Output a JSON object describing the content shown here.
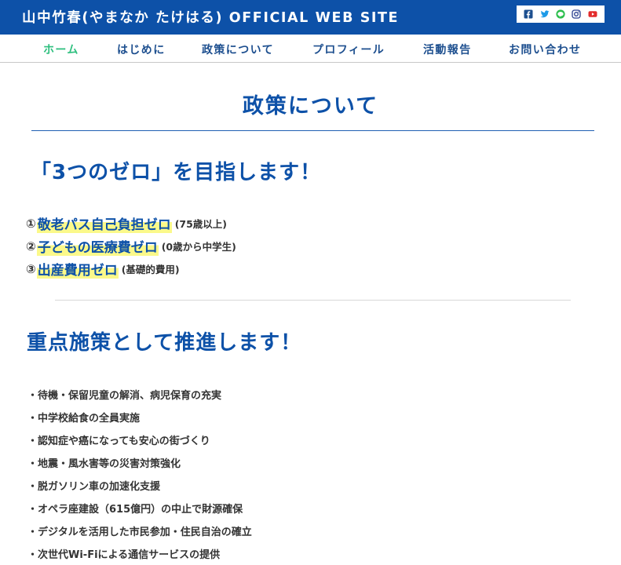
{
  "header": {
    "site_title": "山中竹春(やまなか たけはる) OFFICIAL WEB SITE",
    "social_icons": [
      "facebook-icon",
      "twitter-icon",
      "line-icon",
      "instagram-icon",
      "youtube-icon"
    ],
    "brand_color": "#0d51a8"
  },
  "nav": {
    "items": [
      {
        "label": "ホーム",
        "active": true
      },
      {
        "label": "はじめに",
        "active": false
      },
      {
        "label": "政策について",
        "active": false
      },
      {
        "label": "プロフィール",
        "active": false
      },
      {
        "label": "活動報告",
        "active": false
      },
      {
        "label": "お問い合わせ",
        "active": false
      }
    ],
    "active_color": "#2dbf7e"
  },
  "main": {
    "page_title": "政策について",
    "zero_section": {
      "heading": "「3つのゼロ」を目指します！",
      "items": [
        {
          "num": "①",
          "main": "敬老パス自己負担ゼロ",
          "note": "(75歳以上)"
        },
        {
          "num": "②",
          "main": "子どもの医療費ゼロ",
          "note": "(0歳から中学生)"
        },
        {
          "num": "③",
          "main": "出産費用ゼロ",
          "note": "(基礎的費用)"
        }
      ],
      "highlight_color": "#fbf98a"
    },
    "policy_section": {
      "heading": "重点施策として推進します！",
      "items": [
        "・待機・保留児童の解消、病児保育の充実",
        "・中学校給食の全員実施",
        "・認知症や癌になっても安心の街づくり",
        "・地震・風水害等の災害対策強化",
        "・脱ガソリン車の加速化支援",
        "・オペラ座建設（615億円）の中止で財源確保",
        "・デジタルを活用した市民参加・住民自治の確立",
        "・次世代Wi-Fiによる通信サービスの提供"
      ]
    }
  }
}
